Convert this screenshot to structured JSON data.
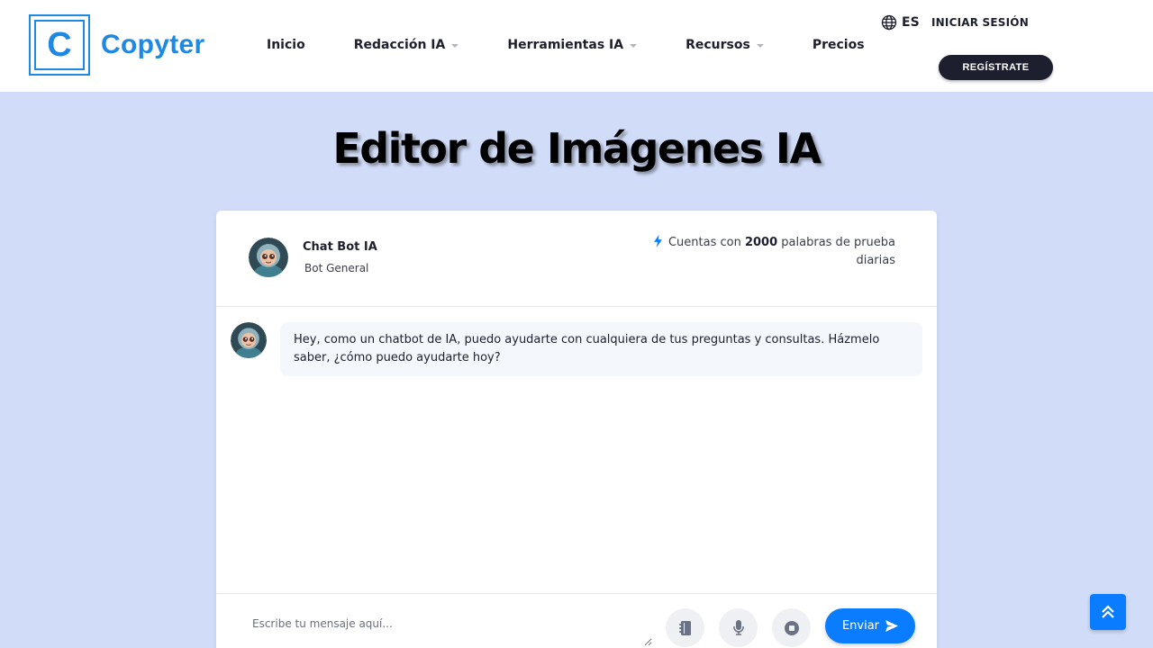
{
  "header": {
    "logo_letter": "C",
    "logo_text": "Copyter",
    "nav": {
      "inicio": "Inicio",
      "redaccion": "Redacción IA",
      "herramientas": "Herramientas IA",
      "recursos": "Recursos",
      "precios": "Precios"
    },
    "language": "ES",
    "login": "INICIAR SESIÓN",
    "register": "REGÍSTRATE"
  },
  "page": {
    "title": "Editor de Imágenes IA"
  },
  "chat": {
    "bot_name": "Chat Bot IA",
    "bot_role": "Bot General",
    "credits_prefix": "Cuentas con",
    "credits_amount": "2000",
    "credits_suffix": "palabras de prueba diarias",
    "messages": [
      {
        "sender": "bot",
        "text": "Hey, como un chatbot de IA, puedo ayudarte con cualquiera de tus preguntas y consultas. Házmelo saber, ¿cómo puedo ayudarte hoy?"
      }
    ],
    "input_placeholder": "Escribe tu mensaje aquí...",
    "send_label": "Enviar"
  },
  "icons": {
    "language": "globe-icon",
    "credits": "bolt-icon",
    "notes": "notebook-icon",
    "mic": "microphone-icon",
    "stop": "stop-icon",
    "send": "paper-plane-icon",
    "scroll_top": "double-chevron-up-icon"
  },
  "colors": {
    "brand_blue": "#1e88e5",
    "accent_blue": "#0a7cff",
    "page_background": "#d0dcf8",
    "dark": "#1e1f2e"
  }
}
